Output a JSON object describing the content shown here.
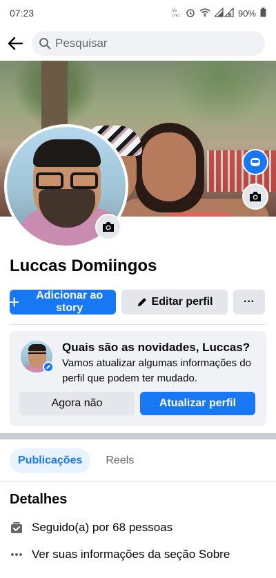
{
  "status_bar": {
    "time": "07:23",
    "volte_label": "Vo\nLTE1",
    "battery_text": "90%"
  },
  "search": {
    "placeholder": "Pesquisar"
  },
  "profile": {
    "name": "Luccas Domiingos"
  },
  "actions": {
    "add_story_label": "Adicionar ao story",
    "edit_profile_label": "Editar perfil",
    "more_label": "···"
  },
  "update_card": {
    "title": "Quais são as novidades, Luccas?",
    "description": "Vamos atualizar algumas informações do perfil que podem ter mudado.",
    "dismiss_label": "Agora não",
    "update_label": "Atualizar perfil"
  },
  "tabs": [
    {
      "label": "Publicações",
      "active": true
    },
    {
      "label": "Reels",
      "active": false
    }
  ],
  "details": {
    "title": "Detalhes",
    "followed_by": "Seguido(a) por 68 pessoas",
    "about": "Ver suas informações da seção Sobre"
  },
  "colors": {
    "accent": "#1877f2",
    "secondary_button": "#e4e6eb",
    "card_background": "#f0f2f5",
    "active_tab_background": "#e7f3ff"
  },
  "icons": {
    "back": "arrow-left-icon",
    "search": "magnifier-icon",
    "cover_camera": "camera-icon",
    "avatar_camera": "camera-icon",
    "cover_avatar": "avatar-frame-icon",
    "edit": "pencil-icon",
    "add": "plus-icon",
    "followed": "followers-icon",
    "about": "dots-icon"
  }
}
